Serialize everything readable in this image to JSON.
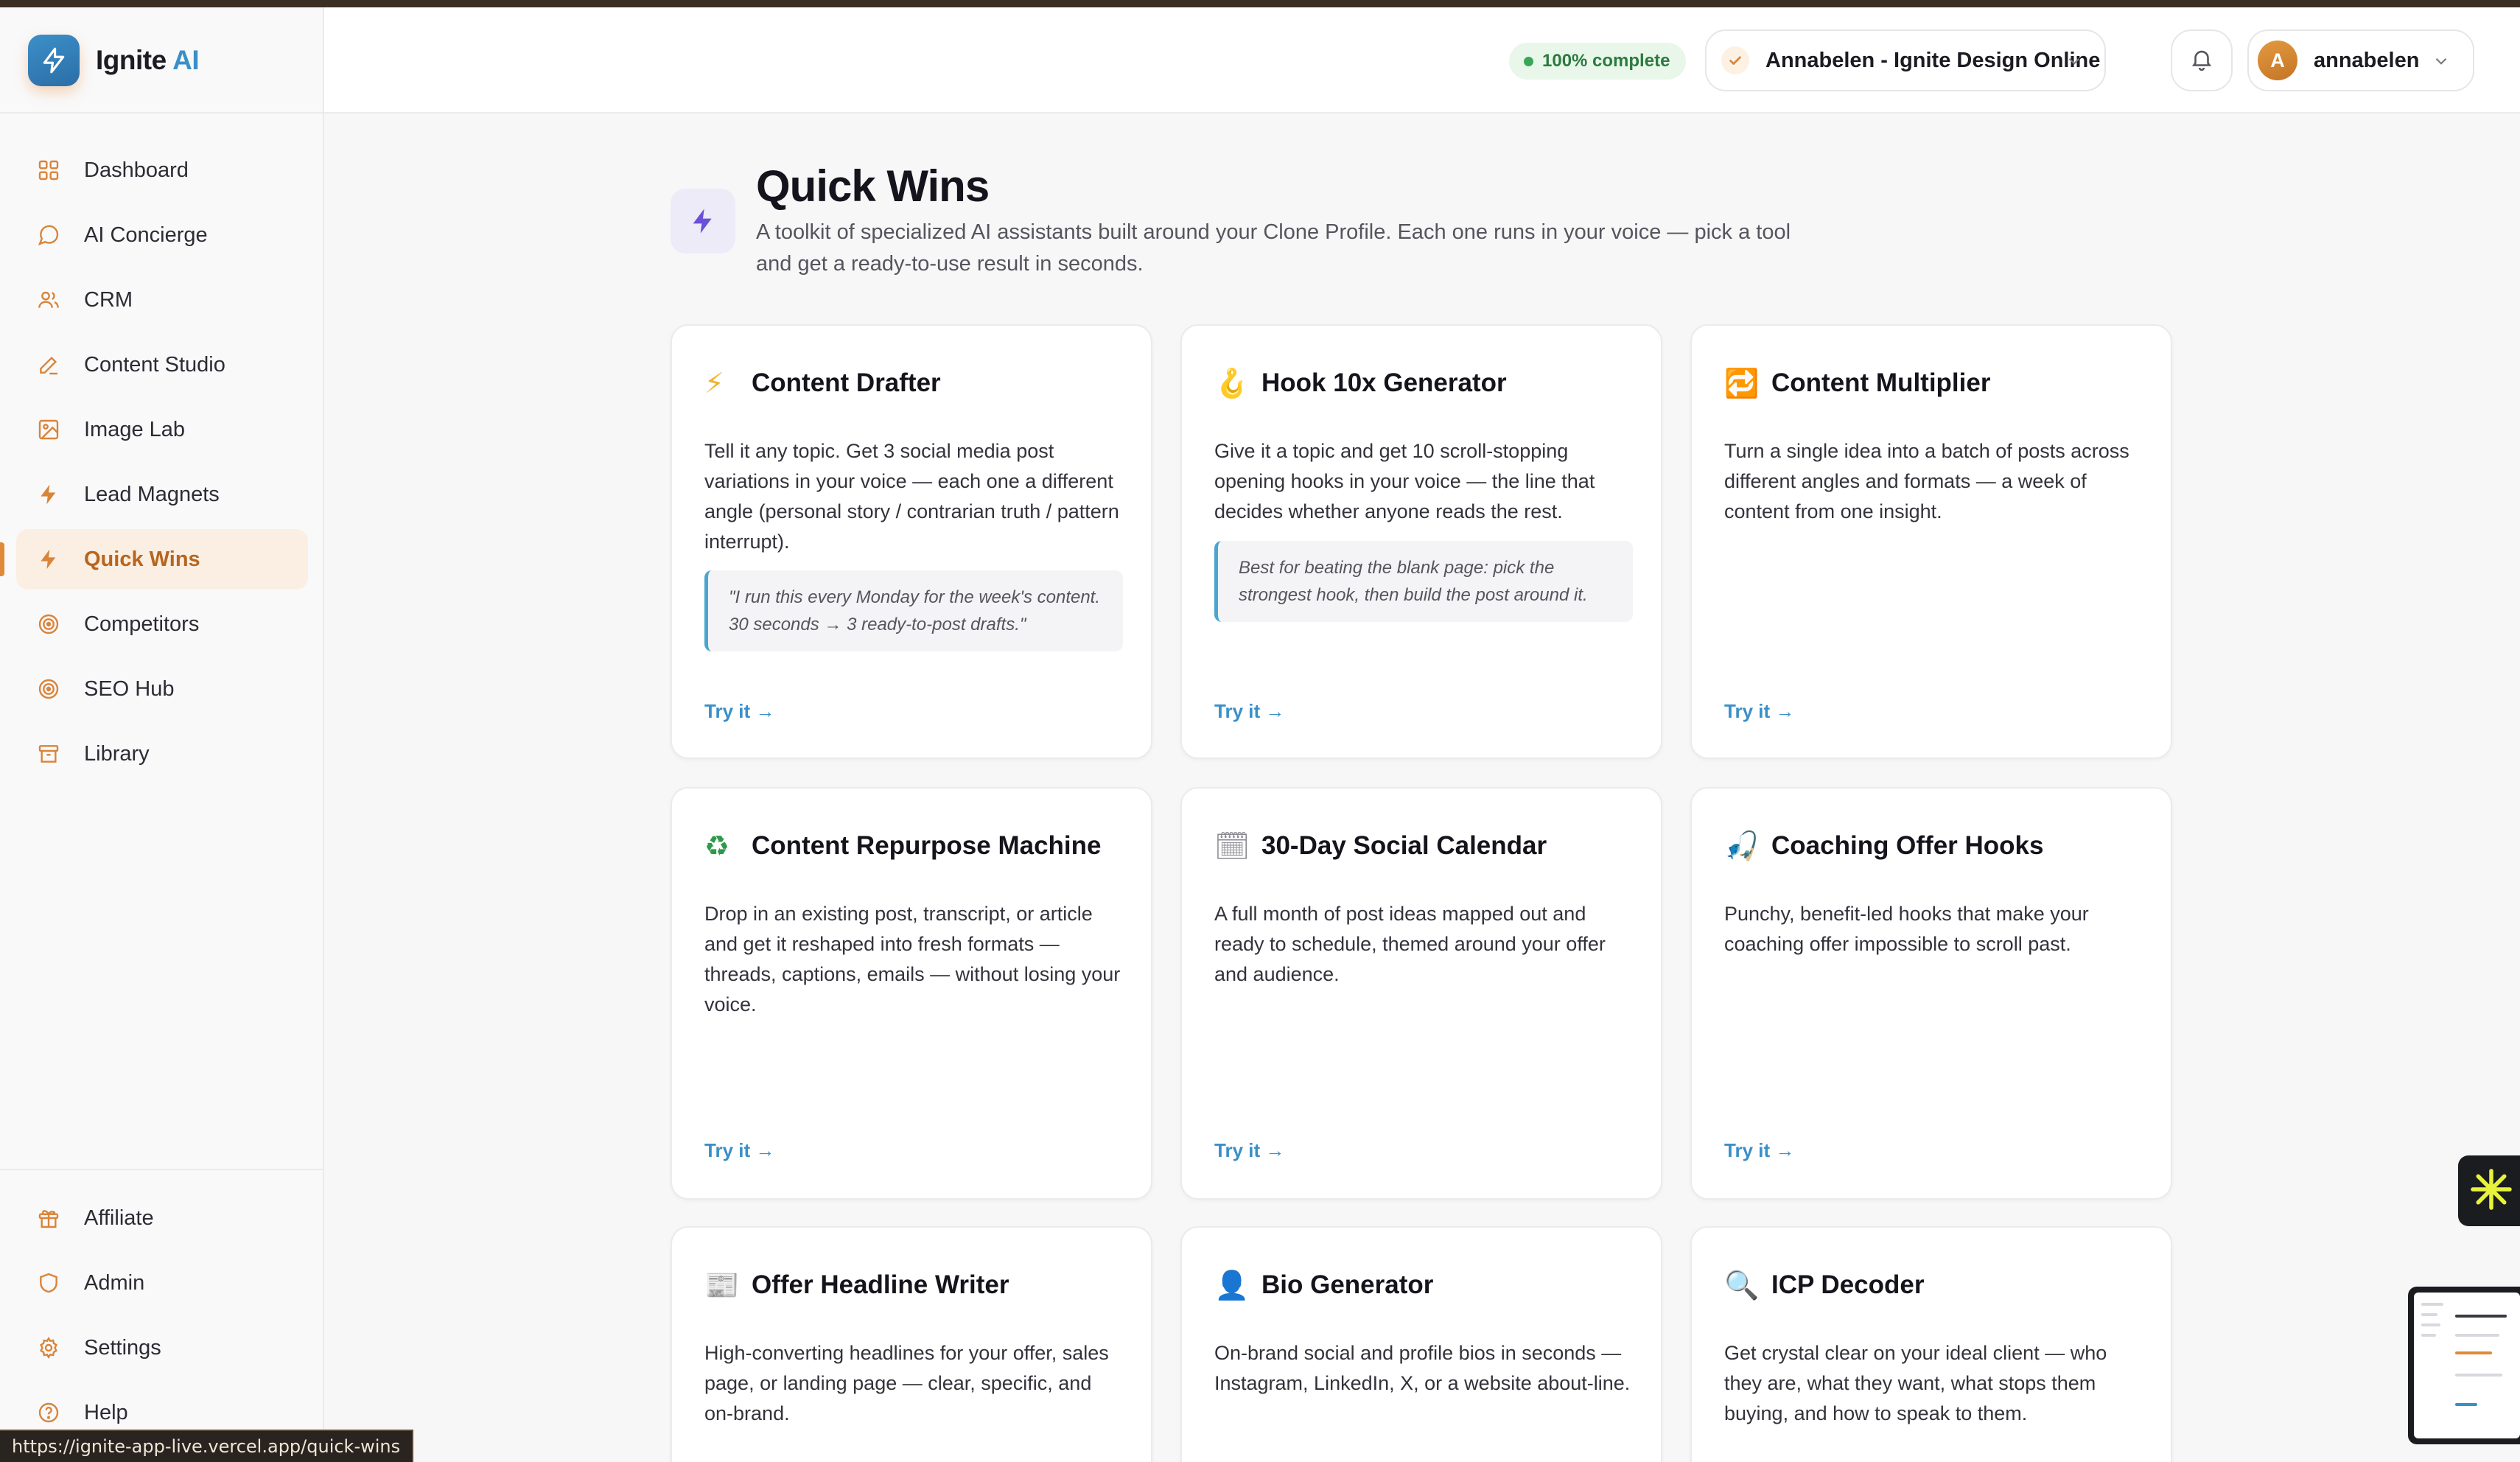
{
  "app": {
    "name_main": "Ignite",
    "name_accent": "AI"
  },
  "sidebar": {
    "items": [
      {
        "label": "Dashboard",
        "icon": "grid-icon"
      },
      {
        "label": "AI Concierge",
        "icon": "chat-bubble-icon"
      },
      {
        "label": "CRM",
        "icon": "users-icon"
      },
      {
        "label": "Content Studio",
        "icon": "pencil-icon"
      },
      {
        "label": "Image Lab",
        "icon": "image-icon"
      },
      {
        "label": "Lead Magnets",
        "icon": "bolt-icon"
      },
      {
        "label": "Quick Wins",
        "icon": "bolt-icon",
        "active": true
      },
      {
        "label": "Competitors",
        "icon": "target-icon"
      },
      {
        "label": "SEO Hub",
        "icon": "target-icon"
      },
      {
        "label": "Library",
        "icon": "archive-icon"
      }
    ],
    "bottom_items": [
      {
        "label": "Affiliate",
        "icon": "gift-icon"
      },
      {
        "label": "Admin",
        "icon": "shield-icon"
      },
      {
        "label": "Settings",
        "icon": "gear-icon"
      },
      {
        "label": "Help",
        "icon": "help-circle-icon"
      }
    ]
  },
  "header": {
    "progress_label": "100% complete",
    "progress_percent": 100,
    "workspace_name": "Annabelen - Ignite Design Online",
    "user_initial": "A",
    "user_name": "annabelen"
  },
  "page": {
    "title": "Quick Wins",
    "description": "A toolkit of specialized AI assistants built around your Clone Profile. Each one runs in your voice — pick a tool and get a ready-to-use result in seconds."
  },
  "cards": [
    {
      "emoji": "⚡",
      "icon": "lightning-emoji-icon",
      "title": "Content Drafter",
      "description": "Tell it any topic. Get 3 social media post variations in your voice — each one a different angle (personal story / contrarian truth / pattern interrupt).",
      "quote": "\"I run this every Monday for the week's content. 30 seconds → 3 ready-to-post drafts.\"",
      "cta": "Try it →"
    },
    {
      "emoji": "🪝",
      "icon": "hook-emoji-icon",
      "title": "Hook 10x Generator",
      "description": "Give it a topic and get 10 scroll-stopping opening hooks in your voice — the line that decides whether anyone reads the rest.",
      "quote": "Best for beating the blank page: pick the strongest hook, then build the post around it.",
      "cta": "Try it →"
    },
    {
      "emoji": "🔁",
      "icon": "repeat-emoji-icon",
      "title": "Content Multiplier",
      "description": "Turn a single idea into a batch of posts across different angles and formats — a week of content from one insight.",
      "cta": "Try it →"
    },
    {
      "emoji": "♻",
      "icon": "recycle-emoji-icon",
      "title": "Content Repurpose Machine",
      "description": "Drop in an existing post, transcript, or article and get it reshaped into fresh formats — threads, captions, emails — without losing your voice.",
      "cta": "Try it →"
    },
    {
      "emoji": "🗓",
      "icon": "calendar-emoji-icon",
      "title": "30-Day Social Calendar",
      "description": "A full month of post ideas mapped out and ready to schedule, themed around your offer and audience.",
      "cta": "Try it →"
    },
    {
      "emoji": "🎣",
      "icon": "fishing-pole-emoji-icon",
      "title": "Coaching Offer Hooks",
      "description": "Punchy, benefit-led hooks that make your coaching offer impossible to scroll past.",
      "cta": "Try it →"
    },
    {
      "emoji": "📰",
      "icon": "newspaper-emoji-icon",
      "title": "Offer Headline Writer",
      "description": "High-converting headlines for your offer, sales page, or landing page — clear, specific, and on-brand."
    },
    {
      "emoji": "👤",
      "icon": "person-emoji-icon",
      "title": "Bio Generator",
      "description": "On-brand social and profile bios in seconds — Instagram, LinkedIn, X, or a website about-line."
    },
    {
      "emoji": "🔍",
      "icon": "magnifier-emoji-icon",
      "title": "ICP Decoder",
      "description": "Get crystal clear on your ideal client — who they are, what they want, what stops them buying, and how to speak to them."
    }
  ],
  "status_bar": {
    "url": "https://ignite-app-live.vercel.app/quick-wins"
  },
  "colors": {
    "accent_orange": "#e08936",
    "accent_blue": "#3a8fc8",
    "success_green": "#3aa657"
  }
}
